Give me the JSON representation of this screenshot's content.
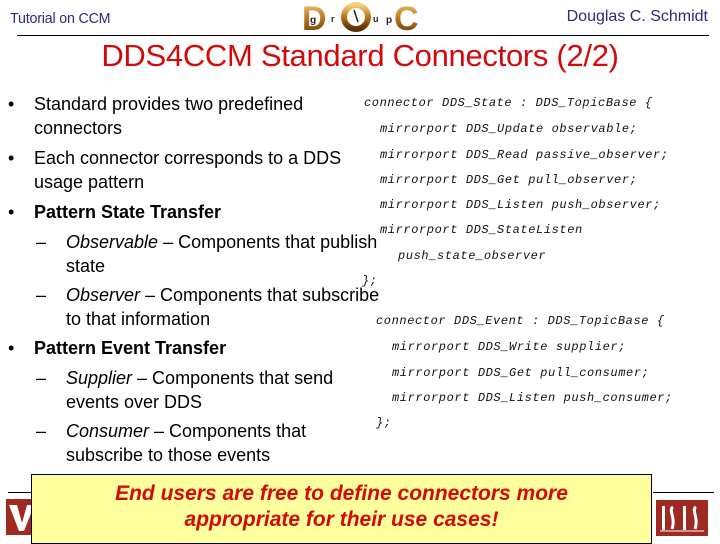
{
  "header": {
    "left_text": "Tutorial on CCM",
    "right_text": "Douglas C. Schmidt",
    "logo": {
      "name": "doc-group-logo",
      "letters": [
        "D",
        "g",
        "r",
        "O",
        "u",
        "p",
        "C"
      ]
    }
  },
  "title": "DDS4CCM Standard Connectors (2/2)",
  "bullets": [
    {
      "type": "bullet",
      "parts": [
        {
          "text": "Standard provides two predefined connectors",
          "style": "normal"
        }
      ]
    },
    {
      "type": "bullet",
      "parts": [
        {
          "text": "Each connector corresponds to a DDS usage pattern",
          "style": "normal"
        }
      ]
    },
    {
      "type": "bullet",
      "parts": [
        {
          "text": "Pattern State Transfer",
          "style": "bold"
        }
      ]
    },
    {
      "type": "sub",
      "parts": [
        {
          "text": "Observable",
          "style": "italic"
        },
        {
          "text": " – Components that publish state",
          "style": "normal"
        }
      ]
    },
    {
      "type": "sub",
      "parts": [
        {
          "text": "Observer",
          "style": "italic"
        },
        {
          "text": " – Components that subscribe to that information",
          "style": "normal"
        }
      ]
    },
    {
      "type": "bullet",
      "parts": [
        {
          "text": "Pattern Event Transfer",
          "style": "bold"
        }
      ]
    },
    {
      "type": "sub",
      "parts": [
        {
          "text": "Supplier",
          "style": "italic"
        },
        {
          "text": " – Components that send events over DDS",
          "style": "normal"
        }
      ]
    },
    {
      "type": "sub",
      "parts": [
        {
          "text": "Consumer",
          "style": "italic"
        },
        {
          "text": " – Components that subscribe to those events",
          "style": "normal"
        }
      ]
    }
  ],
  "code": {
    "state": [
      "connector DDS_State : DDS_TopicBase {",
      "mirrorport DDS_Update observable;",
      "mirrorport DDS_Read passive_observer;",
      "mirrorport DDS_Get pull_observer;",
      "mirrorport DDS_Listen push_observer;",
      "mirrorport DDS_StateListen",
      "push_state_observer",
      "};"
    ],
    "event": [
      "connector DDS_Event : DDS_TopicBase {",
      "mirrorport DDS_Write supplier;",
      "mirrorport DDS_Get pull_consumer;",
      "mirrorport DDS_Listen push_consumer;",
      "};"
    ]
  },
  "callout": {
    "line1": "End users are free to define connectors more",
    "line2": "appropriate for their use cases!"
  },
  "footer": {
    "left_logo": "vanderbilt-logo",
    "right_logo": "isis-logo",
    "right_logo_text": "ISIS"
  },
  "colors": {
    "title": "#d40a0a",
    "header_text": "#2b2b7a",
    "callout_bg": "#ffff9e",
    "callout_text": "#d40a0a",
    "logo_brown": "#9e2a22"
  }
}
